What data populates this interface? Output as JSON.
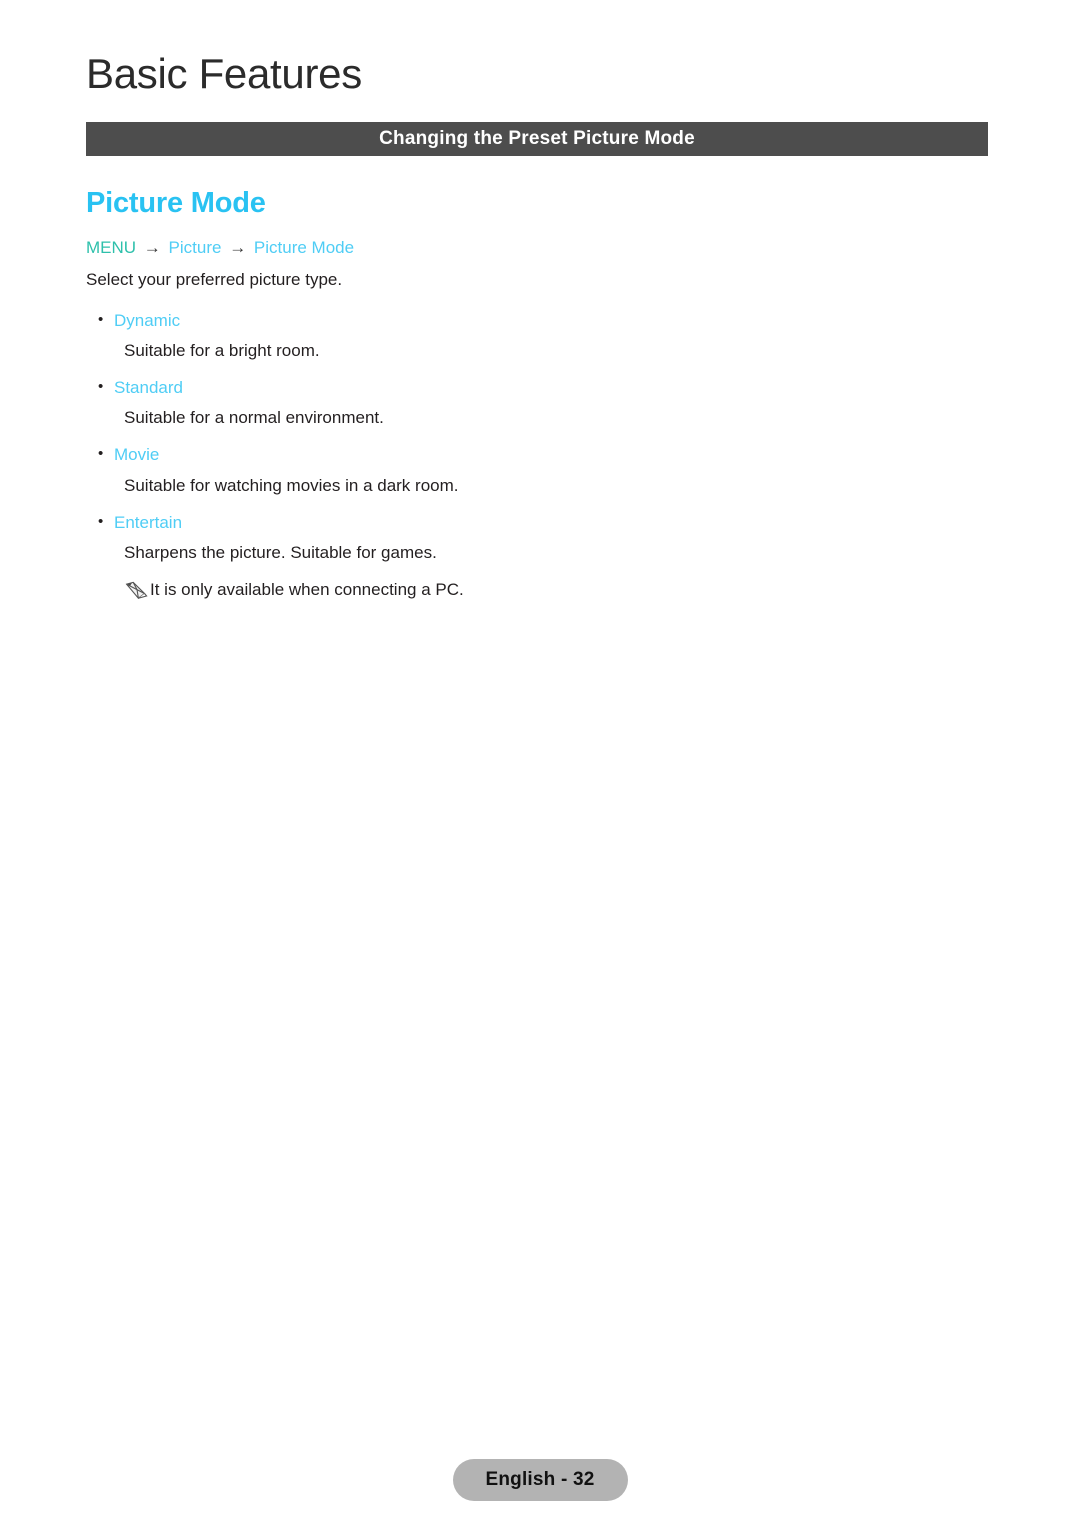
{
  "document": {
    "chapter_title": "Basic Features",
    "section_band_title": "Changing the Preset Picture Mode",
    "colors": {
      "band_background": "#4d4d4d",
      "heading_blue": "#29c2f2",
      "option_blue": "#4fcdf5",
      "menu_root_teal": "#2ec0ab",
      "body_text": "#231f20",
      "footer_pill": "#b3b3b3"
    }
  },
  "feature": {
    "heading": "Picture Mode",
    "menu_path": {
      "root": "MENU",
      "arrow": "→",
      "node1": "Picture",
      "node2": "Picture Mode"
    },
    "intro": "Select your preferred picture type.",
    "options": [
      {
        "bullet": "•",
        "name": "Dynamic",
        "description": "Suitable for a bright room."
      },
      {
        "bullet": "•",
        "name": "Standard",
        "description": "Suitable for a normal environment."
      },
      {
        "bullet": "•",
        "name": "Movie",
        "description": "Suitable for watching movies in a dark room."
      },
      {
        "bullet": "•",
        "name": "Entertain",
        "description": "Sharpens the picture. Suitable for games."
      }
    ],
    "note": {
      "icon": "pencil-note-icon",
      "text": "It is only available when connecting a PC."
    }
  },
  "footer": {
    "page_label": "English - 32"
  }
}
